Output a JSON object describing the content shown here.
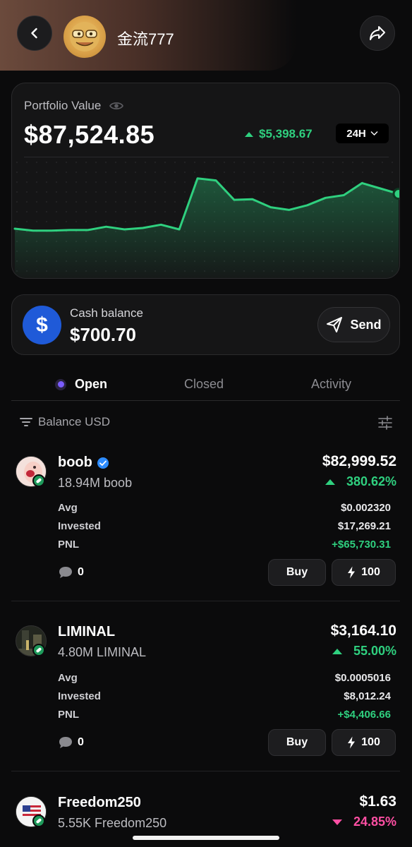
{
  "header": {
    "username": "金流777",
    "back_icon": "chevron-left-icon",
    "share_icon": "share-arrow-icon"
  },
  "portfolio": {
    "label": "Portfolio Value",
    "value": "$87,524.85",
    "change": "$5,398.67",
    "change_direction": "up",
    "timeframe": "24H",
    "chart_data": {
      "type": "area",
      "color": "#2fd07f",
      "values": [
        20,
        17,
        17,
        18,
        18,
        23,
        19,
        21,
        26,
        19,
        95,
        92,
        63,
        64,
        52,
        48,
        55,
        66,
        70,
        88,
        80,
        72
      ]
    }
  },
  "cash": {
    "label": "Cash balance",
    "value": "$700.70",
    "send_label": "Send"
  },
  "tabs": [
    {
      "label": "Open",
      "active": true
    },
    {
      "label": "Closed",
      "active": false
    },
    {
      "label": "Activity",
      "active": false
    }
  ],
  "filter": {
    "label": "Balance USD"
  },
  "holdings": [
    {
      "name": "boob",
      "verified": true,
      "qty": "18.94M boob",
      "value": "$82,999.52",
      "pct": "380.62%",
      "direction": "up",
      "avg_label": "Avg",
      "avg": "$0.002320",
      "invested_label": "Invested",
      "invested": "$17,269.21",
      "pnl_label": "PNL",
      "pnl": "+$65,730.31",
      "comments": "0",
      "buy_label": "Buy",
      "quick_label": "100"
    },
    {
      "name": "LIMINAL",
      "verified": false,
      "qty": "4.80M LIMINAL",
      "value": "$3,164.10",
      "pct": "55.00%",
      "direction": "up",
      "avg_label": "Avg",
      "avg": "$0.0005016",
      "invested_label": "Invested",
      "invested": "$8,012.24",
      "pnl_label": "PNL",
      "pnl": "+$4,406.66",
      "comments": "0",
      "buy_label": "Buy",
      "quick_label": "100"
    },
    {
      "name": "Freedom250",
      "verified": false,
      "qty": "5.55K Freedom250",
      "value": "$1.63",
      "pct": "24.85%",
      "direction": "down"
    }
  ]
}
